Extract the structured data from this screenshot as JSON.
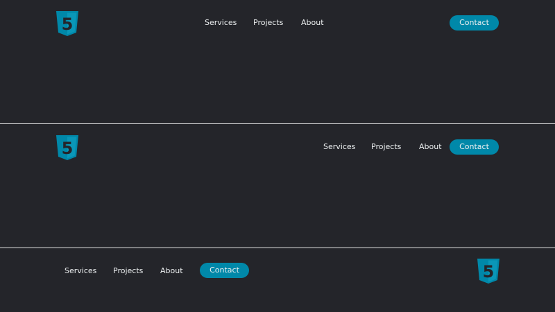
{
  "colors": {
    "background": "#24252a",
    "text": "#edf0f1",
    "accent": "#0088a9",
    "divider": "#e6e6e6"
  },
  "logo": {
    "icon": "html5-logo-icon",
    "digit": "5"
  },
  "variants": [
    {
      "name": "centered-nav",
      "nav": [
        "Services",
        "Projects",
        "About"
      ],
      "cta": "Contact"
    },
    {
      "name": "right-nav",
      "nav": [
        "Services",
        "Projects",
        "About"
      ],
      "cta": "Contact"
    },
    {
      "name": "reversed",
      "nav": [
        "Services",
        "Projects",
        "About"
      ],
      "cta": "Contact"
    }
  ]
}
